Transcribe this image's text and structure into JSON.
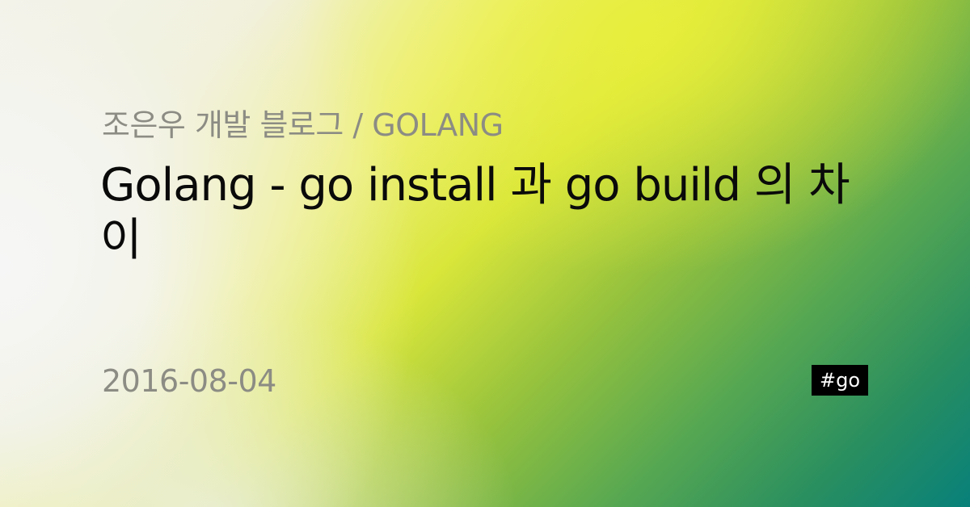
{
  "post": {
    "breadcrumb": "조은우 개발 블로그 / GOLANG",
    "title": "Golang - go install 과 go build 의 차이",
    "date": "2016-08-04",
    "tags": [
      "#go"
    ]
  },
  "colors": {
    "background_start": "#f4f4f2",
    "background_mid": "#d9e63a",
    "background_end": "#08807a",
    "breadcrumb_text": "#8c8c84",
    "title_text": "#0a0a0a",
    "tag_background": "#000000",
    "tag_text": "#ffffff"
  }
}
